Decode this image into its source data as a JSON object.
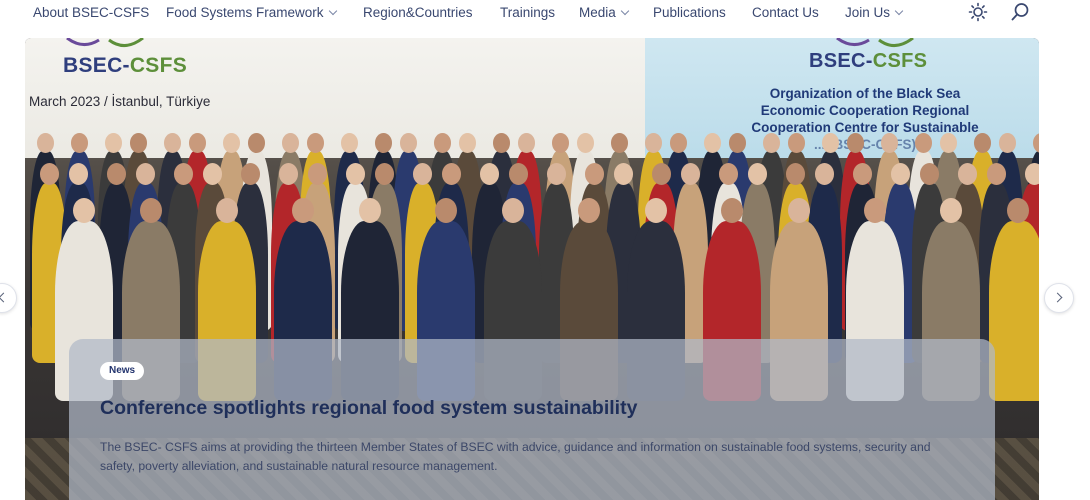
{
  "nav": {
    "items": [
      {
        "label": "About BSEC-CSFS",
        "dropdown": false
      },
      {
        "label": "Food Systems Framework",
        "dropdown": true
      },
      {
        "label": "Region&Countries",
        "dropdown": false
      },
      {
        "label": "Trainings",
        "dropdown": false
      },
      {
        "label": "Media",
        "dropdown": true
      },
      {
        "label": "Publications",
        "dropdown": false
      },
      {
        "label": "Contact Us",
        "dropdown": false
      },
      {
        "label": "Join Us",
        "dropdown": true
      }
    ],
    "icons": [
      "theme-toggle-sun-icon",
      "search-icon"
    ]
  },
  "hero": {
    "banner_left": {
      "logo_text_a": "BSEC-",
      "logo_text_b": "CSFS",
      "date_place": "March 2023 / İstanbul, Türkiye"
    },
    "banner_right": {
      "logo_text_a": "BSEC-",
      "logo_text_b": "CSFS",
      "org_line1": "Organization of the Black Sea",
      "org_line2": "Economic Cooperation Regional",
      "org_line3": "Cooperation Centre for Sustainable",
      "org_line4": "... (BSEC-CSFS)"
    },
    "slide": {
      "badge": "News",
      "title": "Conference spotlights regional food system sustainability",
      "text": "The BSEC- CSFS aims at providing the thirteen Member States of BSEC with advice, guidance and information on sustainable food systems, security and safety, poverty alleviation, and sustainable natural resource management."
    }
  },
  "colors": {
    "nav_text": "#3a4870",
    "title": "#1f2f5a",
    "brand_blue": "#2f3e7d",
    "brand_green": "#5d8f3a"
  }
}
